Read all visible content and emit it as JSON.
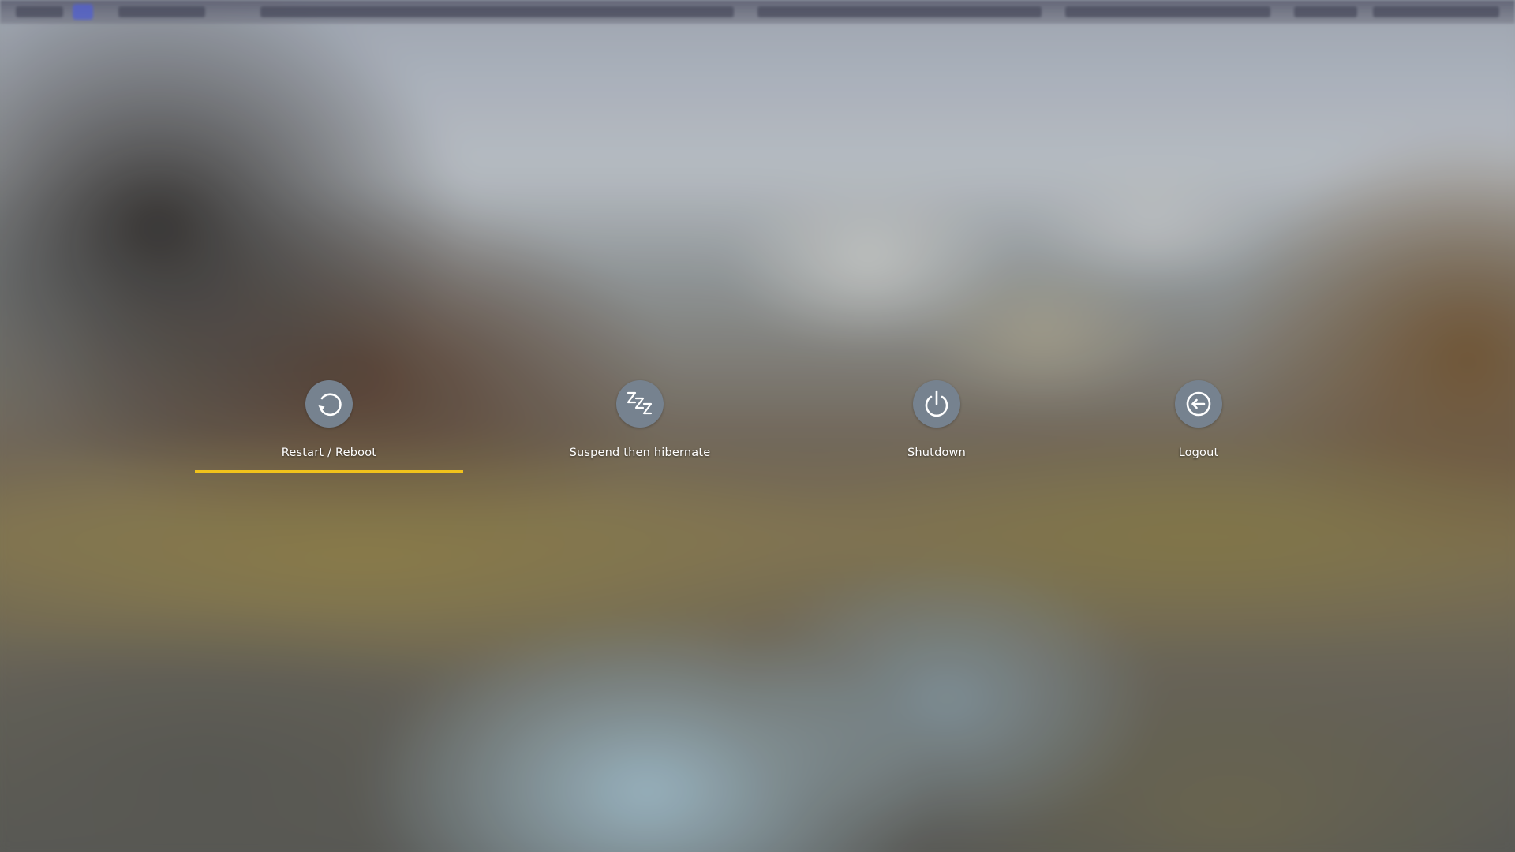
{
  "power_menu": {
    "options": [
      {
        "label": "Restart / Reboot",
        "icon": "restart-icon",
        "selected": true
      },
      {
        "label": "Suspend then hibernate",
        "icon": "sleep-zzz-icon",
        "selected": false
      },
      {
        "label": "Shutdown",
        "icon": "power-icon",
        "selected": false
      },
      {
        "label": "Logout",
        "icon": "logout-icon",
        "selected": false
      }
    ],
    "colors": {
      "button_circle": "#76828f",
      "icon": "#ffffff",
      "label": "#ffffff",
      "focus_underline": "#f1c21b"
    }
  }
}
